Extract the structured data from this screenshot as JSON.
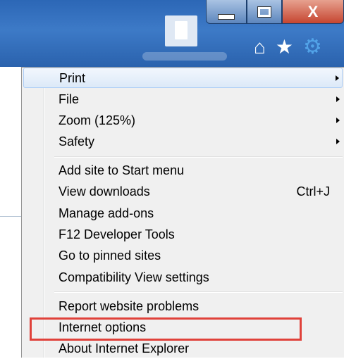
{
  "window": {
    "close_glyph": "X"
  },
  "toolbar_icons": [
    "home-icon",
    "favorites-star-icon",
    "tools-gear-icon"
  ],
  "menu": {
    "groups": [
      [
        {
          "label": "Print",
          "submenu": true
        },
        {
          "label": "File",
          "submenu": true
        },
        {
          "label": "Zoom (125%)",
          "submenu": true
        },
        {
          "label": "Safety",
          "submenu": true
        }
      ],
      [
        {
          "label": "Add site to Start menu"
        },
        {
          "label": "View downloads",
          "shortcut": "Ctrl+J"
        },
        {
          "label": "Manage add-ons"
        },
        {
          "label": "F12 Developer Tools"
        },
        {
          "label": "Go to pinned sites"
        },
        {
          "label": "Compatibility View settings"
        }
      ],
      [
        {
          "label": "Report website problems"
        },
        {
          "label": "Internet options",
          "highlighted": true
        },
        {
          "label": "About Internet Explorer"
        }
      ]
    ]
  },
  "colors": {
    "highlight_border": "#e0413a",
    "titlebar": "#2c67b6",
    "menu_bg": "#f0f0f0"
  }
}
